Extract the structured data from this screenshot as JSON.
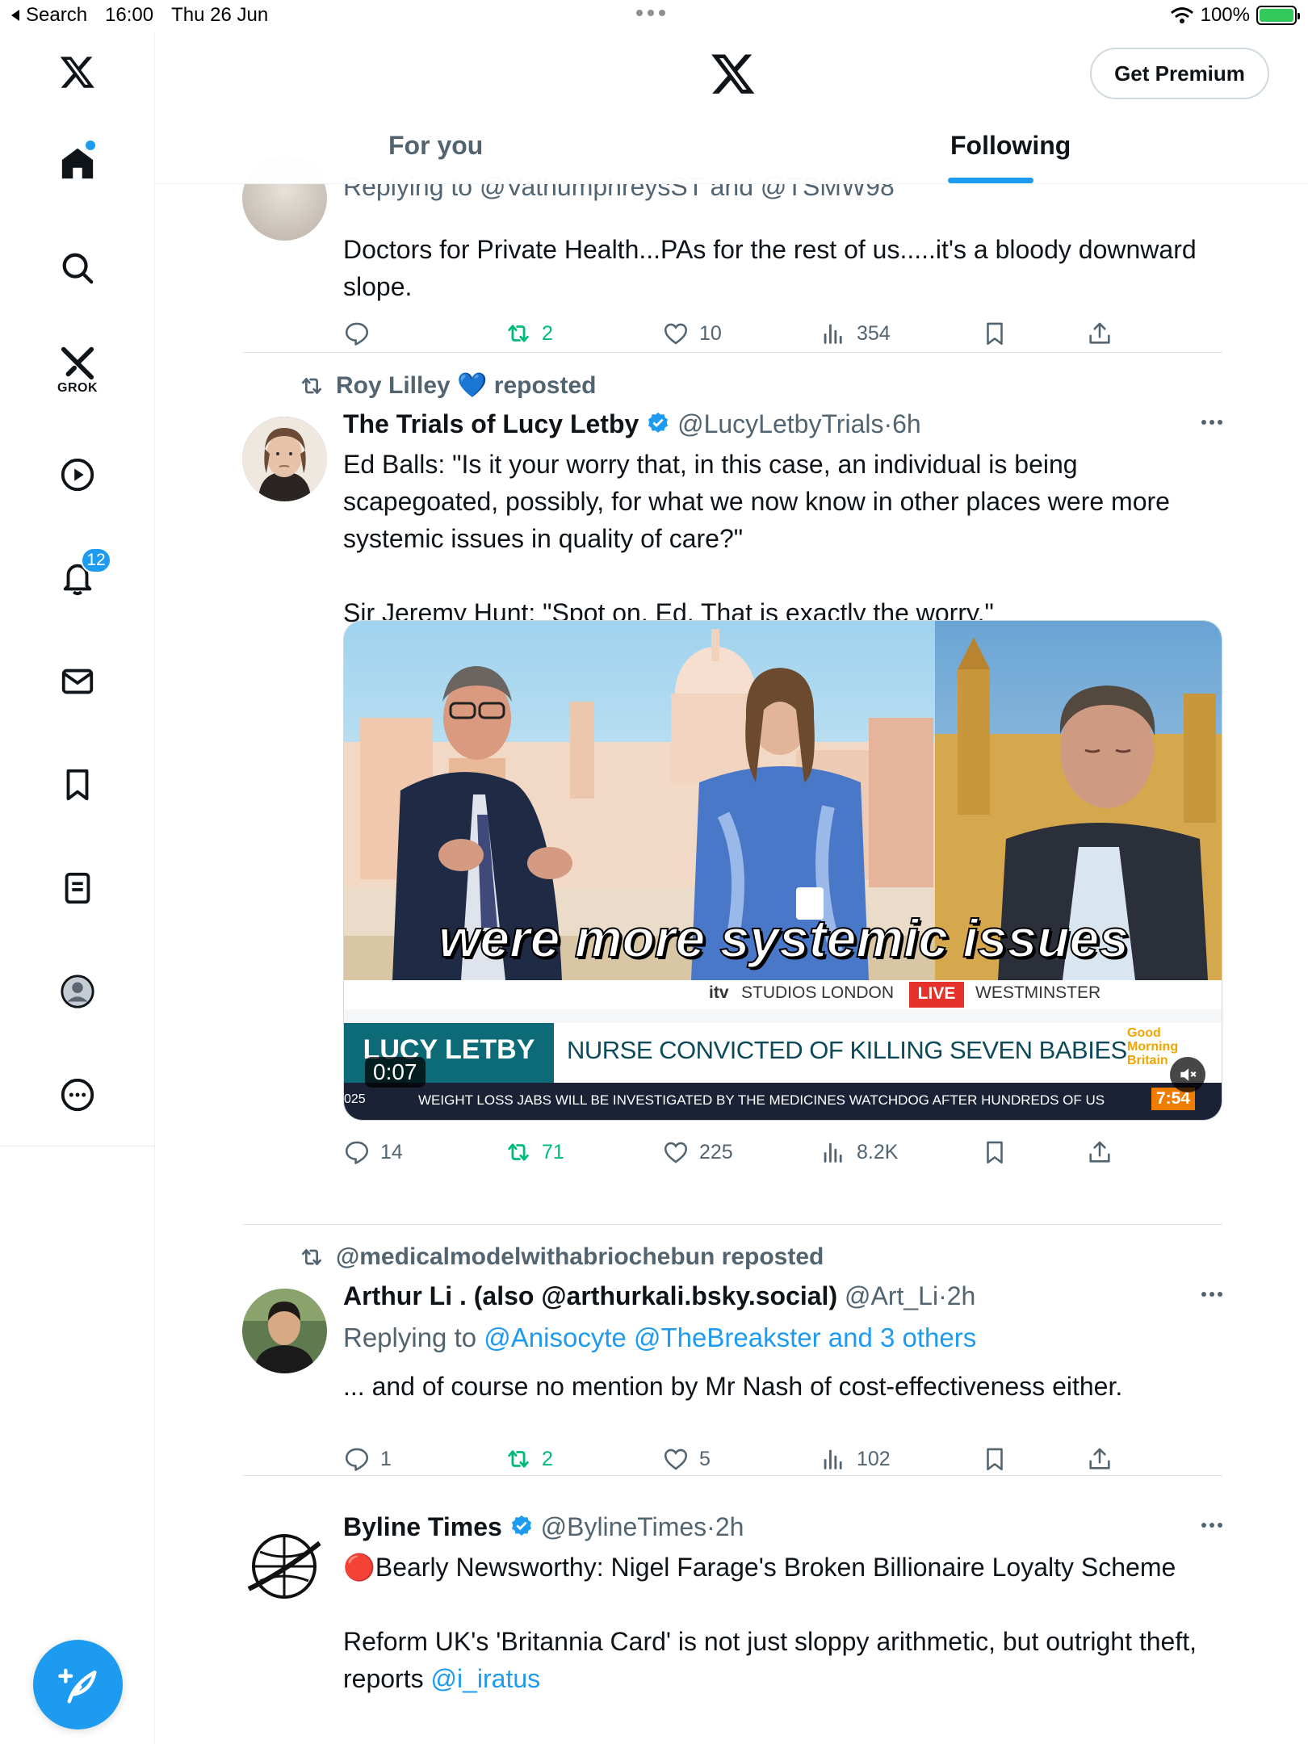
{
  "status_bar": {
    "back_label": "Search",
    "time": "16:00",
    "date": "Thu 26 Jun",
    "battery": "100%"
  },
  "sidebar": {
    "grok_label": "GROK",
    "notifications_badge": "12"
  },
  "header": {
    "premium_label": "Get Premium",
    "tabs": [
      {
        "label": "For you",
        "active": false
      },
      {
        "label": "Following",
        "active": true
      }
    ]
  },
  "tweets": [
    {
      "replying_to_partial": "Replying to @VathumphreysST and @TSMW98",
      "text": "Doctors for Private Health...PAs for the rest of us.....it's a bloody downward slope.",
      "reposts": "2",
      "likes": "10",
      "views": "354"
    },
    {
      "reposted_by": "Roy Lilley",
      "reposted_emoji": "💙",
      "reposted_suffix": "reposted",
      "name": "The Trials of Lucy Letby",
      "handle": "@LucyLetbyTrials",
      "time": "6h",
      "text_1": "Ed Balls: \"Is it your worry that, in this case, an individual is being scapegoated, possibly, for what we now know in other places were more systemic issues in quality of care?\"",
      "text_2": "Sir Jeremy Hunt: \"Spot on, Ed. That is exactly the worry.\"",
      "video": {
        "caption": "were more systemic issues",
        "studio": "STUDIOS LONDON",
        "studio_brand": "itv",
        "live": "LIVE",
        "location": "WESTMINSTER",
        "name_banner": "LUCY LETBY",
        "headline": "NURSE CONVICTED OF KILLING SEVEN BABIES",
        "show_logo": "Good Morning Britain",
        "ticker_prefix": "025",
        "ticker": "WEIGHT LOSS JABS WILL BE INVESTIGATED BY THE MEDICINES WATCHDOG AFTER HUNDREDS OF US",
        "clock": "7:54",
        "timer": "0:07"
      },
      "replies": "14",
      "reposts": "71",
      "likes": "225",
      "views": "8.2K"
    },
    {
      "reposted_by": "@medicalmodelwithabriochebun reposted",
      "name": "Arthur Li . (also @arthurkali.bsky.social)",
      "handle": "@Art_Li",
      "time": "2h",
      "replying_prefix": "Replying to",
      "replying_to": "@Anisocyte @TheBreakster and 3 others",
      "text": "... and of course no mention by Mr Nash of cost-effectiveness either.",
      "replies": "1",
      "reposts": "2",
      "likes": "5",
      "views": "102"
    },
    {
      "name": "Byline Times",
      "handle": "@BylineTimes",
      "time": "2h",
      "text_1": "🔴Bearly Newsworthy: Nigel Farage's Broken Billionaire Loyalty Scheme",
      "text_2": "Reform UK's 'Britannia Card' is not just sloppy arithmetic, but outright theft, reports",
      "text_2_link": "@i_iratus"
    }
  ]
}
